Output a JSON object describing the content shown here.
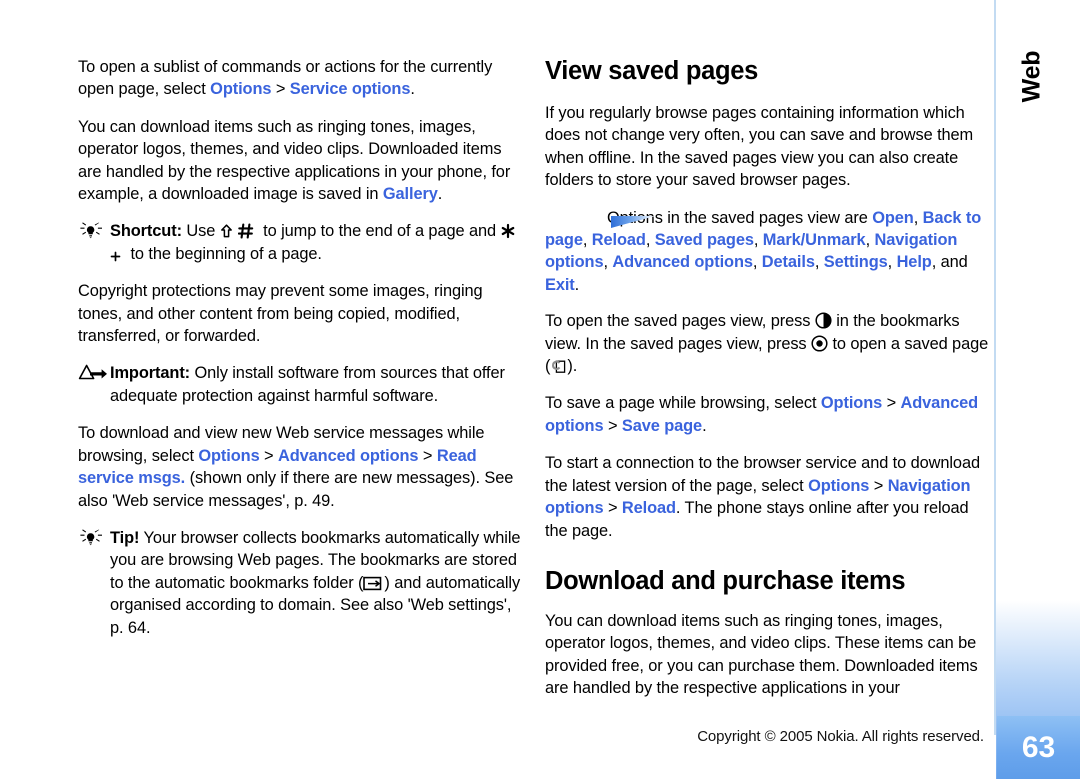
{
  "document": {
    "chapter_tab": "Web",
    "page_number": "63",
    "footer_copyright": "Copyright © 2005 Nokia. All rights reserved.",
    "link_color": "#3a63dd",
    "tab_accent_color": "#6aa6ee",
    "rule_color": "#c3dbf2"
  },
  "left_column": {
    "p1": {
      "a": "To open a sublist of commands or actions for the currently open page, select ",
      "link1": "Options",
      "sep": " > ",
      "link2": "Service options",
      "b": "."
    },
    "p2": {
      "a": "You can download items such as ringing tones, images, operator logos, themes, and video clips. Downloaded items are handled by the respective applications in your phone, for example, a downloaded image is saved in ",
      "link1": "Gallery",
      "b": "."
    },
    "shortcut_note": {
      "label": "Shortcut:",
      "a": " Use ",
      "b": " to jump to the end of a page and ",
      "c": " to the beginning of a page.",
      "icon1": "keypad-up-arrow-icon",
      "icon2": "keypad-hash-icon",
      "icon3": "keypad-asterisk-icon",
      "icon4": "keypad-plus-icon",
      "tip_icon": "lightbulb-tip-icon"
    },
    "p3": "Copyright protections may prevent some images, ringing tones, and other content from being copied, modified, transferred, or forwarded.",
    "important_note": {
      "label": "Important:",
      "text": " Only install software from sources that offer adequate protection against harmful software.",
      "icon": "warning-triangle-arrow-icon"
    },
    "p4": {
      "a": "To download and view new Web service messages while browsing, select ",
      "link1": "Options",
      "sep1": " > ",
      "link2": "Advanced options",
      "sep2": " > ",
      "link3": "Read service msgs.",
      "b": " (shown only if there are new messages). See also 'Web service messages', p. 49."
    },
    "tip_note": {
      "label": "Tip!",
      "a": " Your browser collects bookmarks automatically while you are browsing Web pages. The bookmarks are stored to the automatic bookmarks folder (",
      "b": ") and automatically organised according to domain. See also 'Web settings', p. 64.",
      "icon": "lightbulb-tip-icon",
      "folder_icon": "bookmarks-folder-icon"
    }
  },
  "right_column": {
    "heading1": "View saved pages",
    "p1": "If you regularly browse pages containing information which does not change very often, you can save and browse them when offline. In the saved pages view you can also create folders to store your saved browser pages.",
    "options_note": {
      "marker_icon": "blue-gradient-arrow-marker",
      "a": "Options in the saved pages view are ",
      "items": [
        "Open",
        "Back to page",
        "Reload",
        "Saved pages",
        "Mark/Unmark",
        "Navigation options",
        "Advanced options",
        "Details",
        "Settings",
        "Help"
      ],
      "last_item": "Exit",
      "conj": ", and ",
      "tail": "."
    },
    "p2": {
      "a": "To open the saved pages view, press ",
      "b": " in the bookmarks view. In the saved pages view, press ",
      "c": " to open a saved page (",
      "d": ").",
      "icon1": "scroll-right-key-icon",
      "icon2": "select-key-icon",
      "icon3": "saved-page-icon"
    },
    "p3": {
      "a": "To save a page while browsing, select ",
      "link1": "Options",
      "sep1": " > ",
      "link2": "Advanced options",
      "sep2": " > ",
      "link3": "Save page",
      "b": "."
    },
    "p4": {
      "a": "To start a connection to the browser service and to download the latest version of the page, select ",
      "link1": "Options",
      "sep1": " > ",
      "link2": "Navigation options",
      "sep2": " > ",
      "link3": "Reload",
      "b": ". The phone stays online after you reload the page."
    },
    "heading2": "Download and purchase items",
    "p5": "You can download items such as ringing tones, images, operator logos, themes, and video clips. These items can be provided free, or you can purchase them. Downloaded items are handled by the respective applications in your"
  }
}
